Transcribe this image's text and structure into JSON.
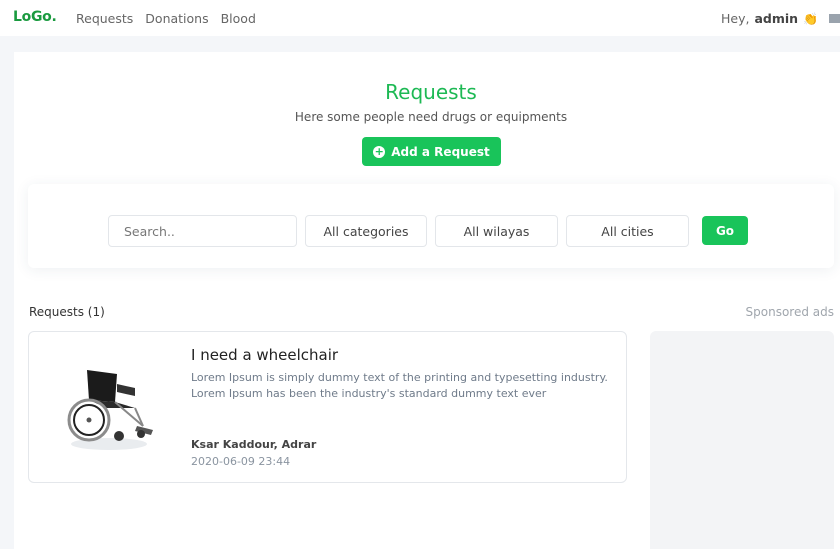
{
  "navbar": {
    "logo": "LoGo.",
    "links": [
      "Requests",
      "Donations",
      "Blood"
    ],
    "greeting": "Hey,",
    "username": "admin",
    "wave_emoji": "👏"
  },
  "hero": {
    "title": "Requests",
    "subtitle": "Here some people need drugs or equipments",
    "add_button": "Add a Request"
  },
  "filters": {
    "search_placeholder": "Search..",
    "category": "All categories",
    "wilaya": "All wilayas",
    "city": "All cities",
    "go_button": "Go"
  },
  "results": {
    "count_label": "Requests (1)",
    "sponsored_label": "Sponsored ads",
    "items": [
      {
        "title": "I need a wheelchair",
        "description": "Lorem Ipsum is simply dummy text of the printing and typesetting industry. Lorem Ipsum has been the industry's standard dummy text ever",
        "location": "Ksar Kaddour, Adrar",
        "date": "2020-06-09 23:44"
      }
    ]
  },
  "colors": {
    "brand_green": "#19c45a",
    "logo_green": "#1a9a3f"
  }
}
